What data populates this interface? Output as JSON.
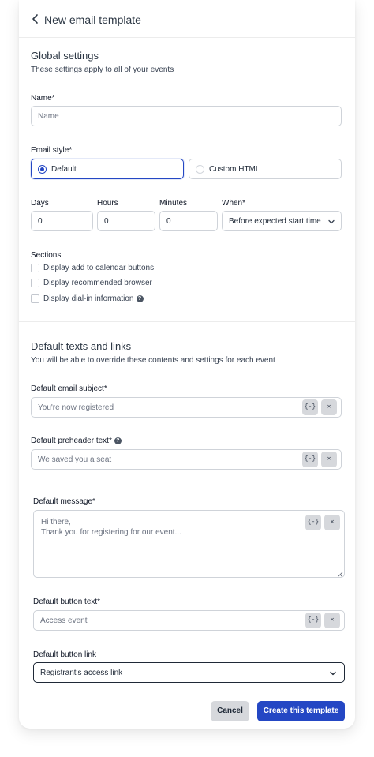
{
  "header": {
    "title": "New email template"
  },
  "global": {
    "title": "Global settings",
    "subtitle": "These settings apply to all of your events",
    "name_label": "Name*",
    "name_placeholder": "Name",
    "style_label": "Email style*",
    "style_options": [
      {
        "label": "Default",
        "selected": true
      },
      {
        "label": "Custom HTML",
        "selected": false
      }
    ],
    "days_label": "Days",
    "days_value": "0",
    "hours_label": "Hours",
    "hours_value": "0",
    "minutes_label": "Minutes",
    "minutes_value": "0",
    "when_label": "When*",
    "when_value": "Before expected start time",
    "sections_label": "Sections",
    "sections": [
      {
        "label": "Display add to calendar buttons",
        "checked": false
      },
      {
        "label": "Display recommended browser",
        "checked": false
      },
      {
        "label": "Display dial-in information",
        "checked": false
      }
    ]
  },
  "defaults": {
    "title": "Default texts and links",
    "subtitle": "You will be able to override these contents and settings for each event",
    "subject_label": "Default email subject*",
    "subject_placeholder": "You're now registered",
    "preheader_label": "Default preheader text*",
    "preheader_placeholder": "We saved you a seat",
    "message_label": "Default message*",
    "message_placeholder": "Hi there,\nThank you for registering for our event...",
    "button_text_label": "Default button text*",
    "button_text_placeholder": "Access event",
    "button_link_label": "Default button link",
    "button_link_value": "Registrant's access link",
    "variable_btn": "{-}",
    "clear_btn": "✕"
  },
  "footer": {
    "cancel_label": "Cancel",
    "create_label": "Create this template"
  },
  "colors": {
    "primary": "#2447c4",
    "neutral_btn": "#d6d8dc"
  }
}
